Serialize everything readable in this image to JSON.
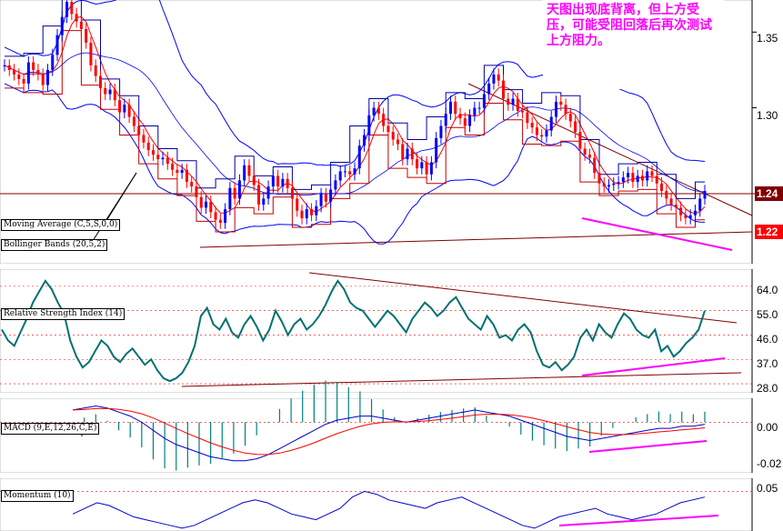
{
  "annotation": {
    "text": "天图出现底背离，但上方受压，可能受阻回落后再次测试上方阻力。",
    "color": "#ff00ff"
  },
  "price_pane": {
    "labels": [
      "Moving Average (C,5,S,0,0)",
      "Bollinger Bands (20,5,2)"
    ],
    "axis_ticks": [
      "1.35",
      "1.30"
    ],
    "price_tags": [
      "1.24",
      "1.22"
    ]
  },
  "rsi_pane": {
    "label": "Relative Strength Index (14)",
    "axis_ticks": [
      "64.0",
      "55.0",
      "46.0",
      "37.0",
      "28.0"
    ]
  },
  "macd_pane": {
    "label": "MACD (9,E,12,26,C,E)",
    "axis_ticks": [
      "0.00",
      "-0.02"
    ]
  },
  "momentum_pane": {
    "label": "Momentum (10)",
    "axis_ticks": [
      "0.05"
    ]
  },
  "colors": {
    "bull_candle": "#0000ff",
    "bear_candle": "#ff0000",
    "bollinger": "#0000ff",
    "moving_average": "#ff0000",
    "rsi_line": "#007070",
    "macd_signal": "#ff0000",
    "divergence_line": "#ff00ff",
    "trend_line": "#800000",
    "price_tag_bg": "#800000",
    "price_tag_low_bg": "#ff0000",
    "momentum_line": "#0000cc"
  },
  "chart_data": [
    {
      "type": "candlestick",
      "ylim": [
        1.2,
        1.37
      ],
      "close": [
        1.328,
        1.325,
        1.322,
        1.319,
        1.316,
        1.33,
        1.325,
        1.322,
        1.315,
        1.325,
        1.335,
        1.348,
        1.36,
        1.37,
        1.362,
        1.357,
        1.352,
        1.343,
        1.328,
        1.321,
        1.313,
        1.309,
        1.312,
        1.305,
        1.297,
        1.302,
        1.294,
        1.288,
        1.282,
        1.277,
        1.272,
        1.269,
        1.266,
        1.267,
        1.263,
        1.259,
        1.257,
        1.259,
        1.251,
        1.248,
        1.241,
        1.234,
        1.238,
        1.231,
        1.226,
        1.224,
        1.233,
        1.247,
        1.24,
        1.252,
        1.262,
        1.255,
        1.249,
        1.236,
        1.24,
        1.248,
        1.255,
        1.248,
        1.253,
        1.247,
        1.24,
        1.232,
        1.227,
        1.233,
        1.229,
        1.235,
        1.243,
        1.238,
        1.246,
        1.252,
        1.258,
        1.258,
        1.256,
        1.26,
        1.275,
        1.282,
        1.295,
        1.3,
        1.296,
        1.288,
        1.284,
        1.279,
        1.276,
        1.266,
        1.273,
        1.266,
        1.26,
        1.264,
        1.256,
        1.264,
        1.28,
        1.288,
        1.296,
        1.304,
        1.296,
        1.293,
        1.288,
        1.295,
        1.3,
        1.3,
        1.309,
        1.316,
        1.322,
        1.318,
        1.306,
        1.302,
        1.306,
        1.298,
        1.297,
        1.29,
        1.287,
        1.282,
        1.281,
        1.285,
        1.294,
        1.304,
        1.302,
        1.296,
        1.291,
        1.284,
        1.273,
        1.269,
        1.267,
        1.257,
        1.25,
        1.248,
        1.249,
        1.25,
        1.251,
        1.254,
        1.257,
        1.251,
        1.255,
        1.252,
        1.258,
        1.255,
        1.25,
        1.245,
        1.24,
        1.236,
        1.234,
        1.229,
        1.227,
        1.229,
        1.232,
        1.24,
        1.245
      ]
    },
    {
      "type": "line",
      "name": "Relative Strength Index (14)",
      "ylim": [
        26,
        69
      ],
      "values": [
        48,
        44,
        42,
        47,
        52,
        58,
        62,
        66,
        63,
        58,
        54,
        44,
        38,
        34,
        36,
        40,
        44,
        42,
        38,
        36,
        39,
        41,
        38,
        35,
        37,
        33,
        30,
        29,
        30,
        32,
        36,
        42,
        53,
        56,
        50,
        48,
        52,
        47,
        45,
        50,
        53,
        49,
        44,
        48,
        55,
        51,
        46,
        50,
        52,
        48,
        50,
        53,
        57,
        62,
        66,
        63,
        58,
        56,
        55,
        52,
        49,
        52,
        55,
        53,
        50,
        47,
        52,
        55,
        58,
        56,
        53,
        55,
        58,
        60,
        56,
        52,
        50,
        48,
        53,
        50,
        45,
        46,
        44,
        48,
        50,
        47,
        40,
        35,
        34,
        36,
        33,
        35,
        38,
        45,
        48,
        44,
        50,
        47,
        45,
        50,
        54,
        52,
        48,
        46,
        45,
        48,
        40,
        42,
        38,
        40,
        43,
        45,
        48,
        55
      ]
    },
    {
      "type": "line",
      "name": "MACD (9,E,12,26,C,E)",
      "ylim": [
        -0.024,
        0.01
      ],
      "values": [
        0.006,
        0.007,
        0.008,
        0.007,
        0.005,
        0.003,
        0,
        -0.004,
        -0.008,
        -0.011,
        -0.013,
        -0.015,
        -0.017,
        -0.018,
        -0.019,
        -0.019,
        -0.018,
        -0.016,
        -0.013,
        -0.01,
        -0.007,
        -0.004,
        -0.001,
        0.001,
        0.002,
        0.003,
        0.003,
        0.002,
        0.001,
        0,
        0.001,
        0.002,
        0.003,
        0.004,
        0.005,
        0.006,
        0.005,
        0.004,
        0.003,
        0.001,
        -0.001,
        -0.003,
        -0.005,
        -0.007,
        -0.008,
        -0.009,
        -0.008,
        -0.007,
        -0.006,
        -0.005,
        -0.004,
        -0.003,
        -0.003,
        -0.002,
        -0.002,
        -0.001
      ]
    },
    {
      "type": "line",
      "name": "Momentum (10)",
      "ylim": [
        -0.02,
        0.07
      ],
      "values": [
        0.01,
        0.02,
        0.03,
        0.025,
        0.015,
        0.005,
        0,
        -0.005,
        -0.01,
        -0.015,
        -0.01,
        0,
        0.01,
        0.02,
        0.03,
        0.035,
        0.03,
        0.02,
        0.01,
        0.005,
        0.0,
        0.01,
        0.02,
        0.04,
        0.05,
        0.045,
        0.035,
        0.03,
        0.025,
        0.02,
        0.03,
        0.035,
        0.04,
        0.03,
        0.02,
        0.01,
        0.0,
        -0.01,
        -0.015,
        -0.005,
        0.005,
        0.01,
        0.015,
        0.02,
        0.01,
        0.005,
        0.0,
        0.005,
        0.01,
        0.02,
        0.03,
        0.035,
        0.04
      ]
    }
  ]
}
